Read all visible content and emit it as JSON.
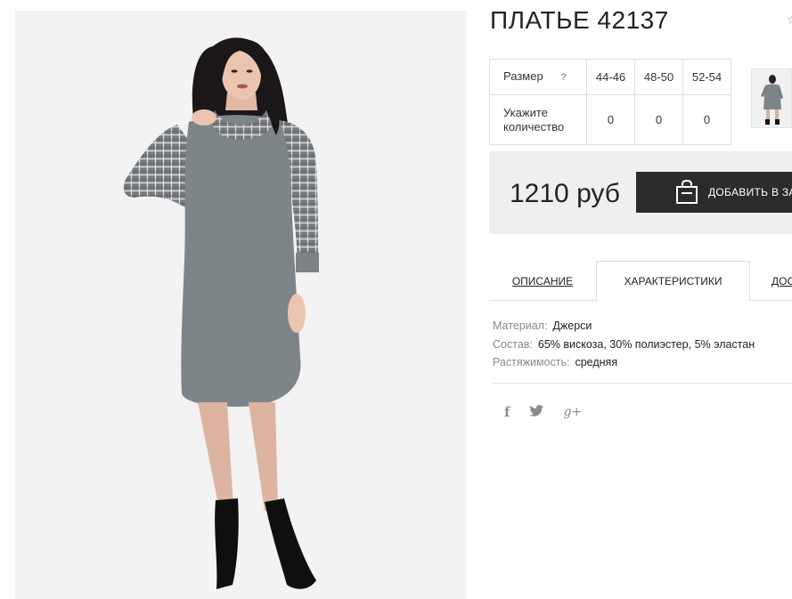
{
  "product": {
    "title": "ПЛАТЬЕ 42137"
  },
  "size_table": {
    "size_label": "Размер",
    "help_icon": "?",
    "sizes": [
      "44-46",
      "48-50",
      "52-54"
    ],
    "qty_label_line1": "Укажите",
    "qty_label_line2": "количество",
    "quantities": [
      "0",
      "0",
      "0"
    ]
  },
  "price": {
    "value": "1210 руб",
    "cart_button_label": "ДОБАВИТЬ В ЗА"
  },
  "tabs": [
    {
      "label": "ОПИСАНИЕ",
      "active": false
    },
    {
      "label": "ХАРАКТЕРИСТИКИ",
      "active": true
    },
    {
      "label": "ДОС",
      "active": false
    }
  ],
  "specs": [
    {
      "key": "Материал:",
      "value": "Джерси"
    },
    {
      "key": "Состав:",
      "value": "65% вискоза, 30% полиэстер, 5% эластан"
    },
    {
      "key": "Растяжимость:",
      "value": "средняя"
    }
  ],
  "social": {
    "facebook": "f",
    "twitter": "🐦",
    "google": "g+"
  },
  "icons": {
    "cart": "shopping-bag-icon"
  },
  "colors": {
    "button_bg": "#2b2b2b",
    "price_bg": "#efefef",
    "border": "#dddddd"
  }
}
